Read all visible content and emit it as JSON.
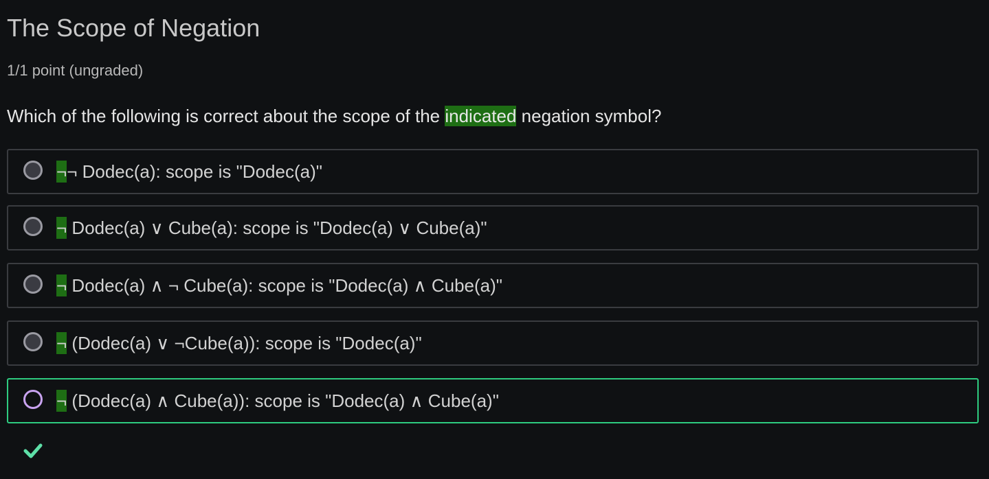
{
  "title": "The Scope of Negation",
  "points": "1/1 point (ungraded)",
  "question": {
    "before": "Which of the following is correct about the scope of the ",
    "highlight": "indicated",
    "after": " negation symbol?"
  },
  "options": [
    {
      "neg": "¬",
      "rest": "¬ Dodec(a): scope is \"Dodec(a)\""
    },
    {
      "neg": "¬",
      "rest": " Dodec(a) ∨ Cube(a): scope is \"Dodec(a) ∨ Cube(a)\""
    },
    {
      "neg": "¬",
      "rest": " Dodec(a) ∧ ¬ Cube(a): scope is \"Dodec(a) ∧ Cube(a)\""
    },
    {
      "neg": "¬",
      "rest": " (Dodec(a) ∨ ¬Cube(a)): scope is \"Dodec(a)\""
    },
    {
      "neg": "¬",
      "rest": " (Dodec(a) ∧ Cube(a)): scope is \"Dodec(a) ∧ Cube(a)\""
    }
  ],
  "selected_index": 4,
  "result_icon": "checkmark-icon",
  "colors": {
    "background": "#0f1113",
    "highlight": "#1e6e14",
    "selected_border": "#2ecc80",
    "check": "#5ee0a8"
  }
}
